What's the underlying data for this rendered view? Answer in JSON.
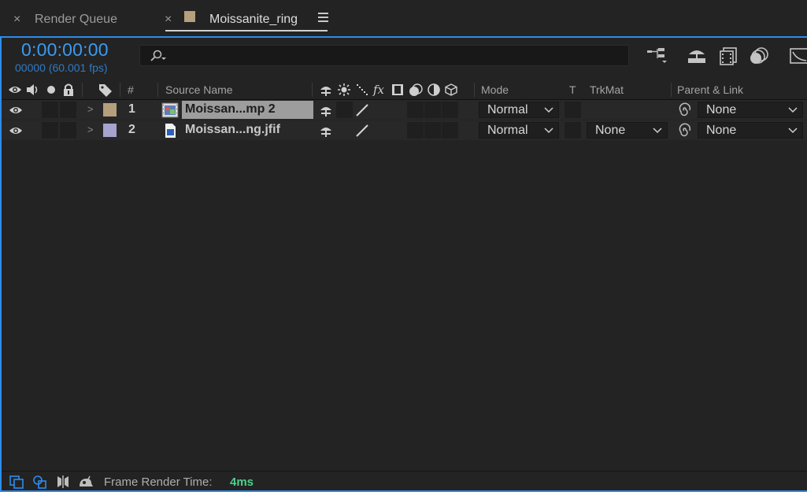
{
  "tabs": [
    {
      "close": "×",
      "label": "Render Queue"
    },
    {
      "close": "×",
      "label": "Moissanite_ring",
      "swatch_color": "#b59f7d"
    }
  ],
  "composition": {
    "timecode": "0:00:00:00",
    "frames_fps": "00000 (60.001 fps)",
    "search_placeholder": ""
  },
  "toolbar_icons": [
    "comp-flowchart-icon",
    "draft-3d-icon",
    "frame-blending-icon",
    "motion-blur-icon",
    "graph-editor-icon"
  ],
  "columns": {
    "hash": "#",
    "source_name": "Source Name",
    "mode": "Mode",
    "t": "T",
    "trkmat": "TrkMat",
    "parent_link": "Parent & Link"
  },
  "layers": [
    {
      "number": "1",
      "name": "Moissan...mp 2",
      "label_color": "#b59f7d",
      "source_type": "precomp-icon",
      "mode": "Normal",
      "trkmat": "",
      "parent": "None",
      "selected": true
    },
    {
      "number": "2",
      "name": "Moissan...ng.jfif",
      "label_color": "#a7a3cf",
      "source_type": "image-file-icon",
      "mode": "Normal",
      "trkmat": "None",
      "parent": "None",
      "selected": false
    }
  ],
  "status": {
    "frame_render_label": "Frame Render Time:",
    "frame_render_value": "4ms"
  },
  "colors": {
    "accent_blue": "#2d8ceb",
    "timecode_blue": "#3a9bf0",
    "render_time_green": "#4fcf8c"
  }
}
